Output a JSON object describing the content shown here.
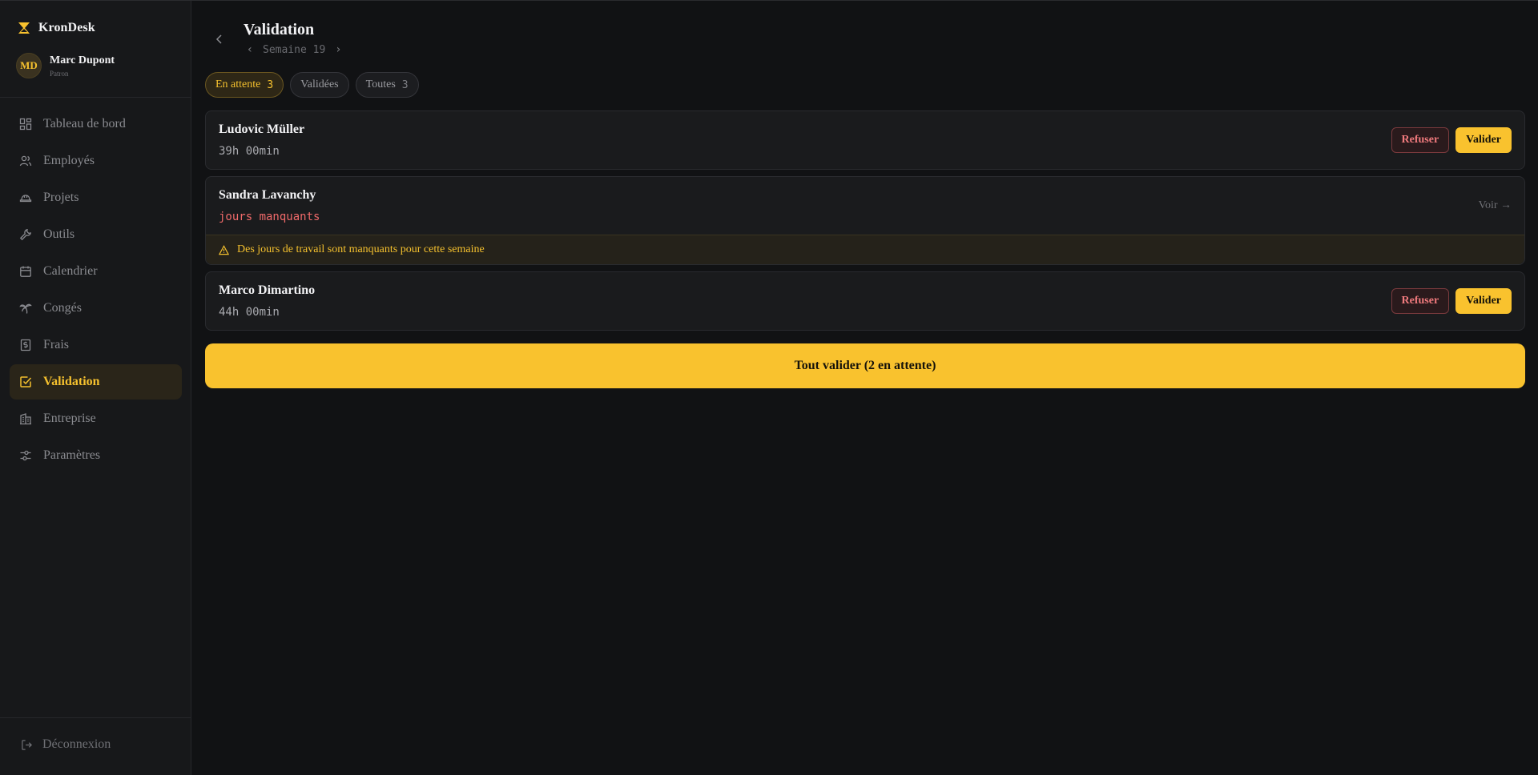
{
  "brand": {
    "name": "KronDesk",
    "logo_icon": "hourglass-icon",
    "accent": "#f9c22e"
  },
  "user": {
    "initials": "MD",
    "name": "Marc Dupont",
    "role": "Patron"
  },
  "sidebar": {
    "items": [
      {
        "label": "Tableau de bord",
        "icon": "dashboard-icon",
        "active": false
      },
      {
        "label": "Employés",
        "icon": "users-icon",
        "active": false
      },
      {
        "label": "Projets",
        "icon": "hard-hat-icon",
        "active": false
      },
      {
        "label": "Outils",
        "icon": "wrench-icon",
        "active": false
      },
      {
        "label": "Calendrier",
        "icon": "calendar-icon",
        "active": false
      },
      {
        "label": "Congés",
        "icon": "palm-tree-icon",
        "active": false
      },
      {
        "label": "Frais",
        "icon": "receipt-icon",
        "active": false
      },
      {
        "label": "Validation",
        "icon": "check-square-icon",
        "active": true
      },
      {
        "label": "Entreprise",
        "icon": "building-icon",
        "active": false
      },
      {
        "label": "Paramètres",
        "icon": "sliders-icon",
        "active": false
      }
    ],
    "logout_label": "Déconnexion"
  },
  "header": {
    "title": "Validation",
    "week_label": "Semaine 19",
    "prev": "‹",
    "next": "›"
  },
  "filters": [
    {
      "label": "En attente",
      "count": "3",
      "active": true
    },
    {
      "label": "Validées",
      "count": "",
      "active": false
    },
    {
      "label": "Toutes",
      "count": "3",
      "active": false
    }
  ],
  "entries": [
    {
      "name": "Ludovic Müller",
      "hours": "39h 00min",
      "refuse_label": "Refuser",
      "validate_label": "Valider"
    },
    {
      "name": "Sandra Lavanchy",
      "status": "jours manquants",
      "view_label": "Voir →",
      "warning": "Des jours de travail sont manquants pour cette semaine"
    },
    {
      "name": "Marco Dimartino",
      "hours": "44h 00min",
      "refuse_label": "Refuser",
      "validate_label": "Valider"
    }
  ],
  "validate_all_label": "Tout valider (2 en attente)"
}
